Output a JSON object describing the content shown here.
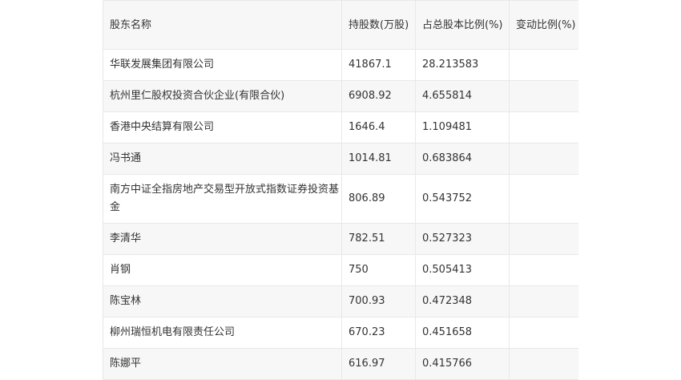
{
  "headers": [
    "股东名称",
    "持股数(万股)",
    "占总股本比例(%)",
    "变动比例(%)"
  ],
  "rows": [
    {
      "name": "华联发展集团有限公司",
      "shares": "41867.1",
      "ratio": "28.213583",
      "change": ""
    },
    {
      "name": "杭州里仁股权投资合伙企业(有限合伙)",
      "shares": "6908.92",
      "ratio": "4.655814",
      "change": ""
    },
    {
      "name": "香港中央结算有限公司",
      "shares": "1646.4",
      "ratio": "1.109481",
      "change": ""
    },
    {
      "name": "冯书通",
      "shares": "1014.81",
      "ratio": "0.683864",
      "change": ""
    },
    {
      "name": "南方中证全指房地产交易型开放式指数证券投资基金",
      "shares": "806.89",
      "ratio": "0.543752",
      "change": ""
    },
    {
      "name": "李清华",
      "shares": "782.51",
      "ratio": "0.527323",
      "change": ""
    },
    {
      "name": "肖钢",
      "shares": "750",
      "ratio": "0.505413",
      "change": ""
    },
    {
      "name": "陈宝林",
      "shares": "700.93",
      "ratio": "0.472348",
      "change": ""
    },
    {
      "name": "柳州瑞恒机电有限责任公司",
      "shares": "670.23",
      "ratio": "0.451658",
      "change": ""
    },
    {
      "name": "陈娜平",
      "shares": "616.97",
      "ratio": "0.415766",
      "change": ""
    }
  ]
}
